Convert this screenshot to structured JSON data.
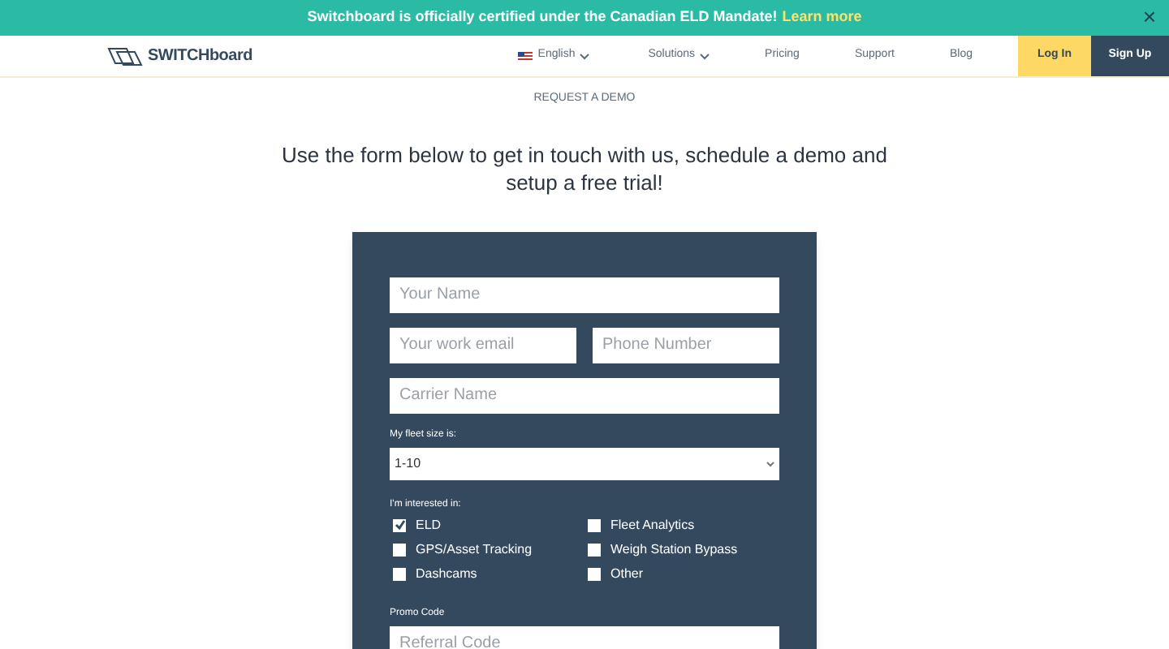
{
  "banner": {
    "text": "Switchboard is officially certified under the Canadian ELD Mandate!",
    "link": "Learn more",
    "close": "×"
  },
  "header": {
    "logo": "SWITCHboard",
    "nav": [
      {
        "label": "English",
        "kind": "language"
      },
      {
        "label": "Solutions",
        "kind": "dropdown"
      },
      {
        "label": "Pricing",
        "kind": "link"
      },
      {
        "label": "Support",
        "kind": "link"
      },
      {
        "label": "Blog",
        "kind": "link"
      }
    ],
    "login": "Log In",
    "signup": "Sign Up"
  },
  "eyebrow": "REQUEST A DEMO",
  "heading": "Use the form below to get in touch with us, schedule a demo and setup a free trial!",
  "form": {
    "name": {
      "placeholder": "Your Name"
    },
    "email": {
      "placeholder": "Your work email"
    },
    "phone": {
      "placeholder": "Phone Number"
    },
    "carrier": {
      "placeholder": "Carrier Name"
    },
    "fleet_label": "My fleet size is:",
    "fleet_value": "1-10",
    "interest_label": "I'm interested in:",
    "interests": [
      {
        "label": "ELD",
        "checked": true
      },
      {
        "label": "Fleet Analytics",
        "checked": false
      },
      {
        "label": "GPS/Asset Tracking",
        "checked": false
      },
      {
        "label": "Weigh Station Bypass",
        "checked": false
      },
      {
        "label": "Dashcams",
        "checked": false
      },
      {
        "label": "Other",
        "checked": false
      }
    ],
    "promo_label": "Promo Code",
    "promo": {
      "placeholder": "Referral Code"
    }
  }
}
